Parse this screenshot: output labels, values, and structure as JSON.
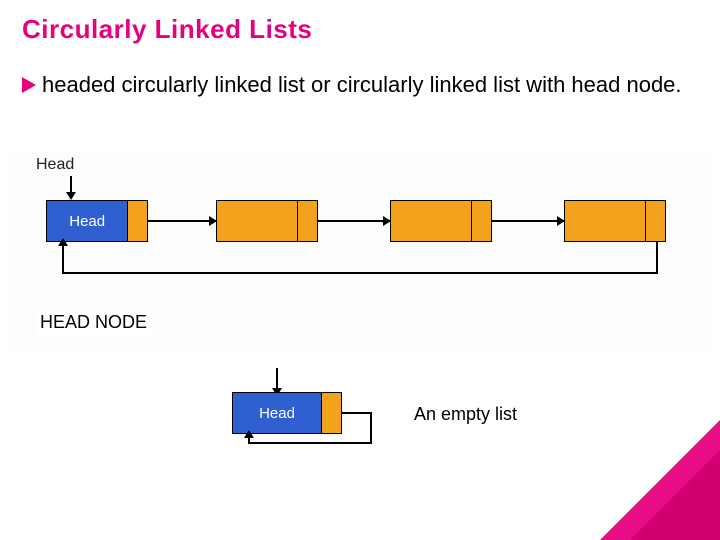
{
  "title": "Circularly  Linked Lists",
  "bullet_text": "headed circularly linked list or circularly linked list with head node.",
  "diagram": {
    "head_pointer_label": "Head",
    "head_node_label": "Head",
    "headnode_section_label": "HEAD NODE",
    "empty_head_label": "Head",
    "empty_list_caption": "An empty list",
    "nodes": [
      {
        "role": "head",
        "data": "Head"
      },
      {
        "role": "data",
        "data": ""
      },
      {
        "role": "data",
        "data": ""
      },
      {
        "role": "data",
        "data": ""
      }
    ],
    "topology": "circular-singly-linked-list-with-head-node",
    "empty_topology": "head-node-self-loop"
  },
  "colors": {
    "accent": "#e6007e",
    "head_node": "#2f5fd0",
    "data_node": "#f2a21d"
  }
}
